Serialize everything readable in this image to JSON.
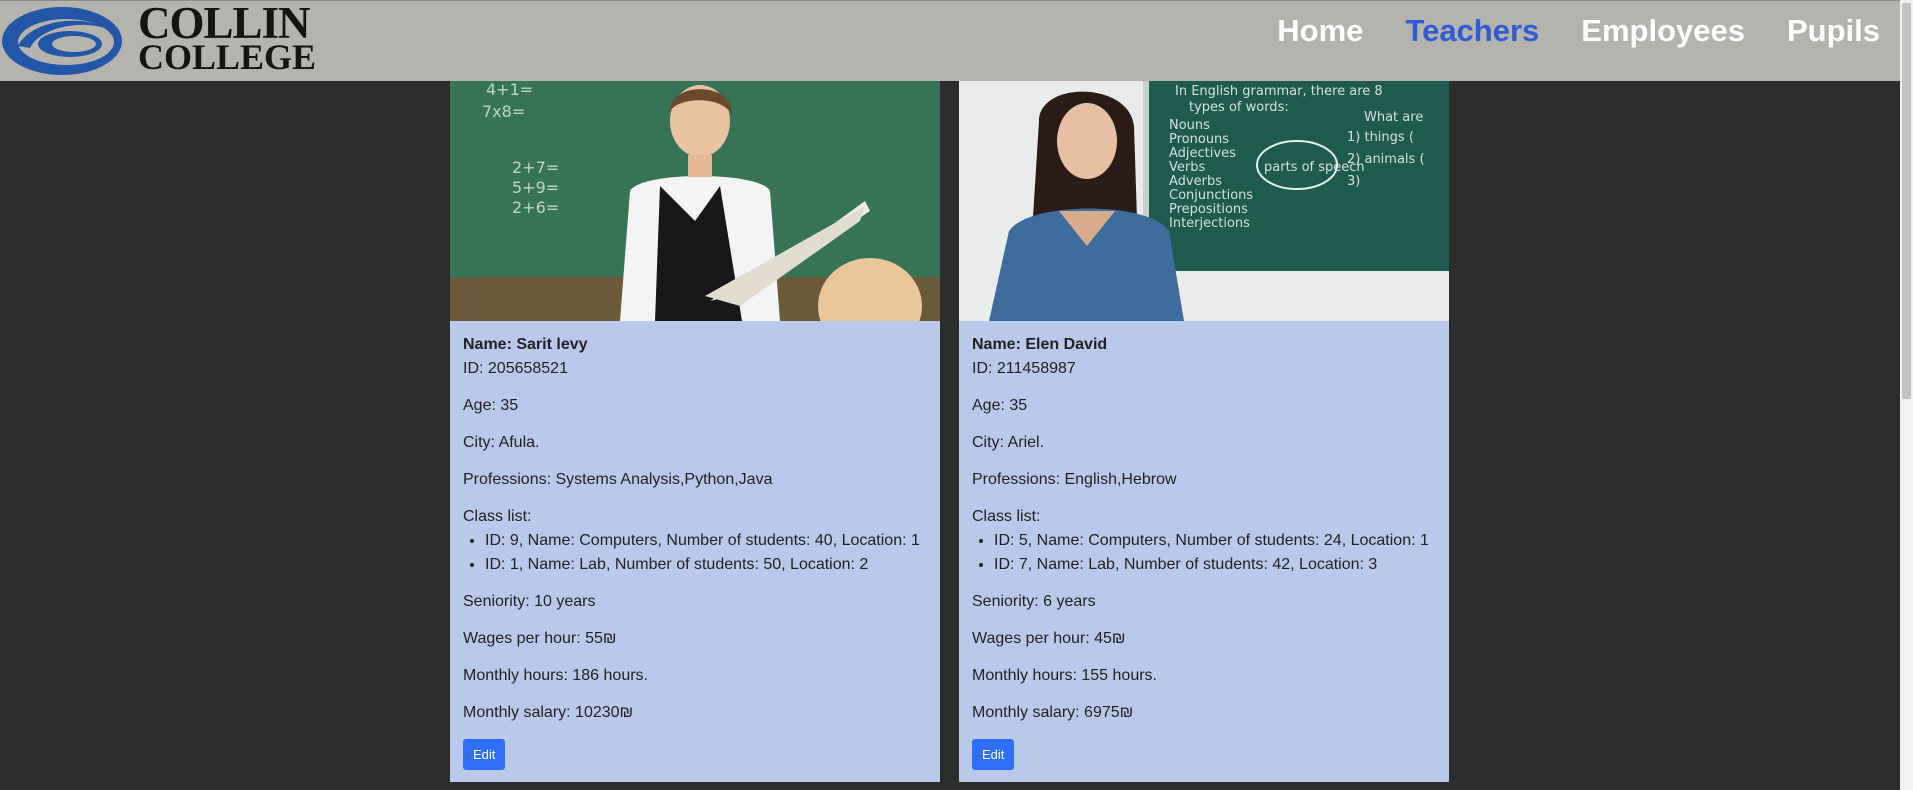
{
  "brand": {
    "line1": "COLLIN",
    "line2": "COLLEGE",
    "color": "#2456a7"
  },
  "nav": {
    "items": [
      {
        "label": "Home",
        "active": false
      },
      {
        "label": "Teachers",
        "active": true
      },
      {
        "label": "Employees",
        "active": false
      },
      {
        "label": "Pupils",
        "active": false
      }
    ]
  },
  "teachers": [
    {
      "name": "Name: Sarit levy",
      "id": "ID: 205658521",
      "age": "Age: 35",
      "city": "City: Afula.",
      "professions": "Professions: Systems Analysis,Python,Java",
      "class_list_label": "Class list:",
      "classes": [
        "ID: 9, Name: Computers, Number of students: 40, Location: 1",
        "ID: 1, Name: Lab, Number of students: 50, Location: 2"
      ],
      "seniority": "Seniority: 10 years",
      "wages": "Wages per hour: 55₪",
      "monthly_hours": "Monthly hours: 186 hours.",
      "monthly_salary": "Monthly salary: 10230₪",
      "edit_label": "Edit"
    },
    {
      "name": "Name: Elen David",
      "id": "ID: 211458987",
      "age": "Age: 35",
      "city": "City: Ariel.",
      "professions": "Professions: English,Hebrow",
      "class_list_label": "Class list:",
      "classes": [
        "ID: 5, Name: Computers, Number of students: 24, Location: 1",
        "ID: 7, Name: Lab, Number of students: 42, Location: 3"
      ],
      "seniority": "Seniority: 6 years",
      "wages": "Wages per hour: 45₪",
      "monthly_hours": "Monthly hours: 155 hours.",
      "monthly_salary": "Monthly salary: 6975₪",
      "edit_label": "Edit"
    }
  ],
  "photo_1_board_text": [
    "4+1=",
    "7x8=",
    "2+7=",
    "5+9=",
    "2+6="
  ],
  "photo_2_board_text": {
    "heading": "In English grammar, there are 8",
    "heading2": "types of words:",
    "left": [
      "Nouns",
      "Pronouns",
      "Adjectives",
      "Verbs",
      "Adverbs",
      "Conjunctions",
      "Prepositions",
      "Interjections"
    ],
    "center": "parts of speech",
    "right": [
      "What are",
      "1) things (",
      "2) animals (",
      "3)"
    ]
  }
}
